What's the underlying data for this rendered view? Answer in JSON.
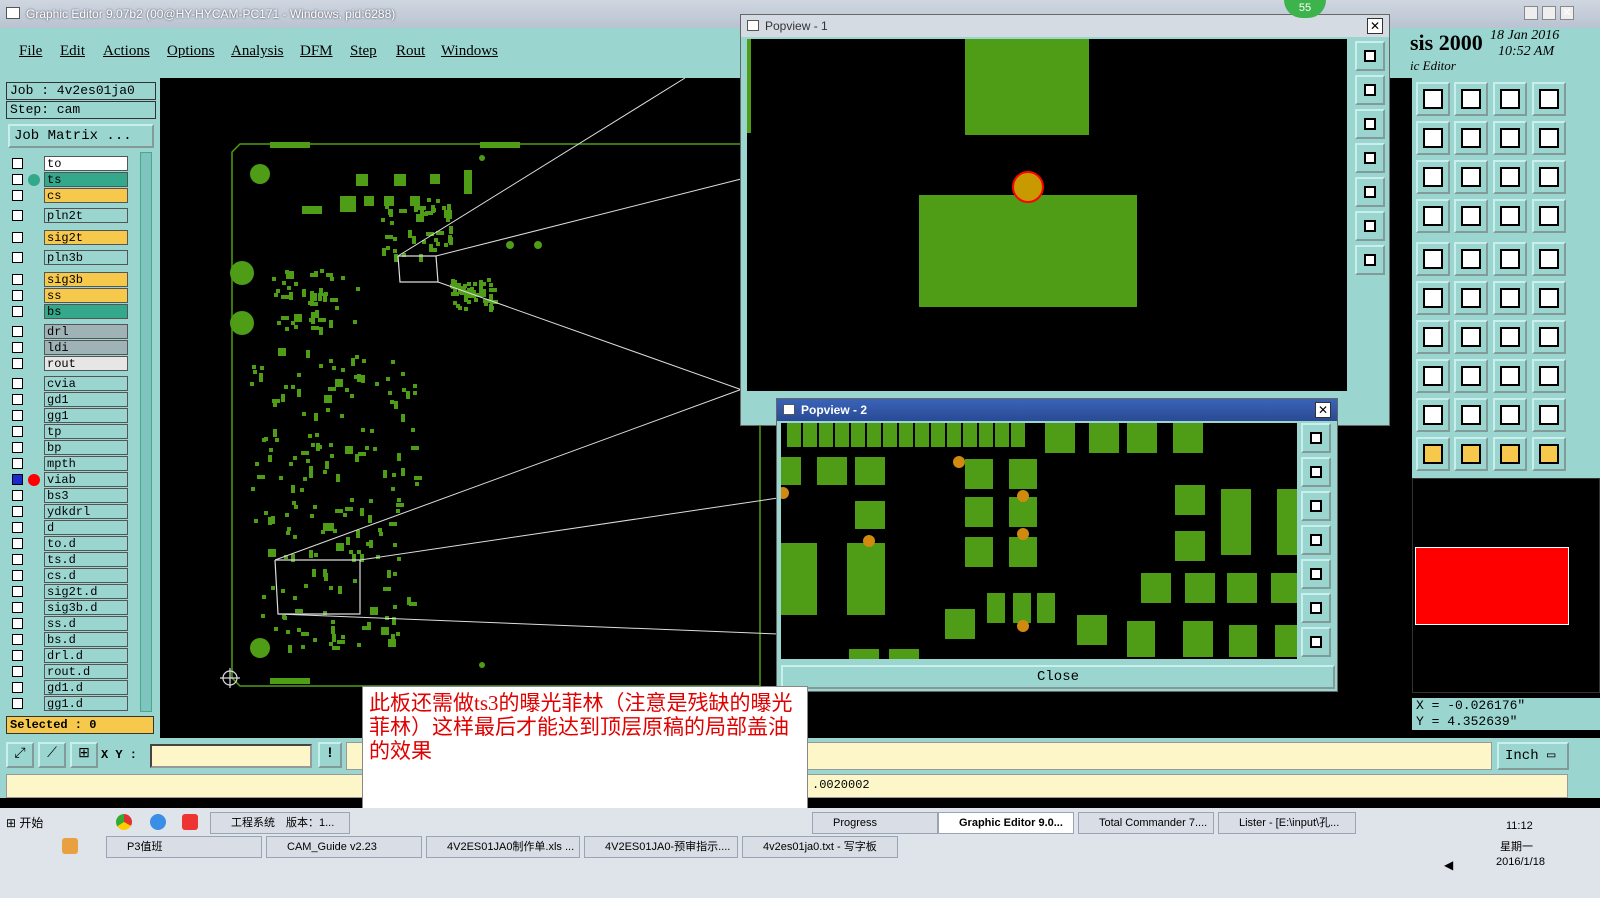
{
  "window_title": "Graphic Editor 9.07b2 (00@HY-HYCAM-PC171 - Windows, pid:6288)",
  "menu": [
    "File",
    "Edit",
    "Actions",
    "Options",
    "Analysis",
    "DFM",
    "Step",
    "Rout",
    "Windows"
  ],
  "job_label": "Job : 4v2es01ja0",
  "step_label": "Step: cam",
  "job_matrix_button": "Job Matrix ...",
  "layers": [
    {
      "name": "to",
      "color": "#ffffff"
    },
    {
      "name": "ts",
      "color": "#33a88a"
    },
    {
      "name": "cs",
      "color": "#f6c84c"
    },
    {
      "name": "pln2t",
      "color": "#9bd5d0"
    },
    {
      "name": "sig2t",
      "color": "#f6c84c"
    },
    {
      "name": "pln3b",
      "color": "#9bd5d0"
    },
    {
      "name": "sig3b",
      "color": "#f6c84c"
    },
    {
      "name": "ss",
      "color": "#f6c84c"
    },
    {
      "name": "bs",
      "color": "#33a88a"
    },
    {
      "name": "drl",
      "color": "#9fb3b6"
    },
    {
      "name": "ldi",
      "color": "#9fb3b6"
    },
    {
      "name": "rout",
      "color": "#e6e6e6"
    },
    {
      "name": "cvia",
      "color": "#9bd5d0"
    },
    {
      "name": "gd1",
      "color": "#9bd5d0"
    },
    {
      "name": "gg1",
      "color": "#9bd5d0"
    },
    {
      "name": "tp",
      "color": "#9bd5d0"
    },
    {
      "name": "bp",
      "color": "#9bd5d0"
    },
    {
      "name": "mpth",
      "color": "#9bd5d0"
    },
    {
      "name": "viab",
      "color": "#9bd5d0"
    },
    {
      "name": "bs3",
      "color": "#9bd5d0"
    },
    {
      "name": "ydkdrl",
      "color": "#9bd5d0"
    },
    {
      "name": "d",
      "color": "#9bd5d0"
    },
    {
      "name": "to.d",
      "color": "#9bd5d0"
    },
    {
      "name": "ts.d",
      "color": "#9bd5d0"
    },
    {
      "name": "cs.d",
      "color": "#9bd5d0"
    },
    {
      "name": "sig2t.d",
      "color": "#9bd5d0"
    },
    {
      "name": "sig3b.d",
      "color": "#9bd5d0"
    },
    {
      "name": "ss.d",
      "color": "#9bd5d0"
    },
    {
      "name": "bs.d",
      "color": "#9bd5d0"
    },
    {
      "name": "drl.d",
      "color": "#9bd5d0"
    },
    {
      "name": "rout.d",
      "color": "#9bd5d0"
    },
    {
      "name": "gd1.d",
      "color": "#9bd5d0"
    },
    {
      "name": "gg1.d",
      "color": "#9bd5d0"
    }
  ],
  "selected_label": "Selected : 0",
  "xy_label": "X Y :",
  "xy_input_value": "",
  "status_value": ".0020002",
  "logo_text": "sis 2000",
  "logo_sub": "ic Editor",
  "date": "18 Jan 2016",
  "time": "10:52 AM",
  "coord_x": "X = -0.026176\"",
  "coord_y": "Y =  4.352639\"",
  "units_button": "Inch",
  "badge": "55",
  "popview1_title": "Popview - 1",
  "popview2_title": "Popview - 2",
  "close_button": "Close",
  "annotation": "此板还需做ts3的曝光菲林（注意是残缺的曝光菲林）这样最后才能达到顶层原稿的局部盖油的效果",
  "taskbar": {
    "start": "开始",
    "row1": [
      "工程系统　版本：1...",
      "Progress",
      "Graphic Editor 9.0...",
      "Total Commander 7....",
      "Lister - [E:\\input\\孔..."
    ],
    "row2": [
      "P3值班",
      "CAM_Guide v2.23",
      "4V2ES01JA0制作单.xls ...",
      "4V2ES01JA0-预审指示....",
      "4v2es01ja0.txt - 写字板"
    ],
    "clock_time": "11:12",
    "clock_day": "星期一",
    "clock_date": "2016/1/18"
  },
  "colors": {
    "panel": "#9bd5d0",
    "pcb_green": "#4f9d17",
    "highlight": "#ff0000",
    "annotation_text": "#e00000"
  }
}
